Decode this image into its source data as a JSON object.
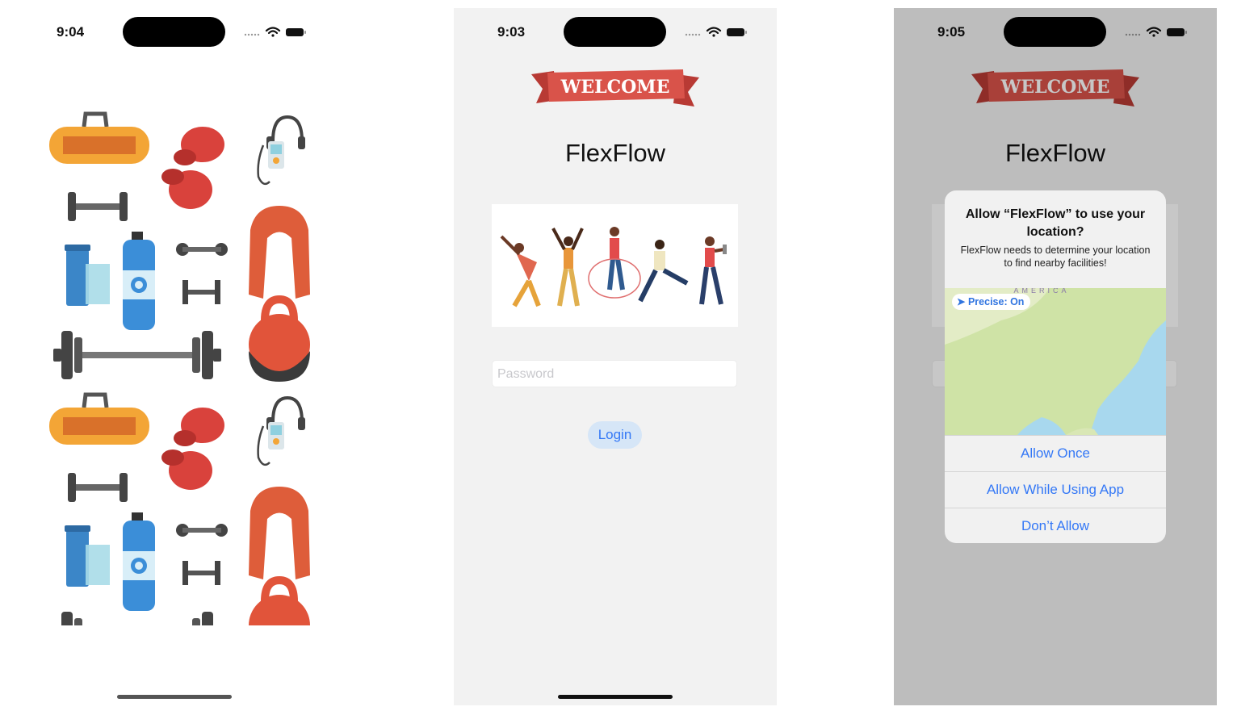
{
  "screens": [
    {
      "status_time": "9:04"
    },
    {
      "status_time": "9:03",
      "banner_text": "WELCOME",
      "app_title": "FlexFlow",
      "password_placeholder": "Password",
      "login_label": "Login"
    },
    {
      "status_time": "9:05",
      "banner_text": "WELCOME",
      "app_title": "FlexFlow",
      "alert": {
        "title": "Allow “FlexFlow” to use your location?",
        "message": "FlexFlow needs to determine your location to find nearby facilities!",
        "map_label": "AMERICA",
        "precise_label": "Precise: On",
        "buttons": [
          "Allow Once",
          "Allow While Using App",
          "Don’t Allow"
        ]
      }
    }
  ],
  "colors": {
    "accent": "#3478f6",
    "banner_red": "#d9534a",
    "phone_bg": "#f2f2f2",
    "dim_bg": "#c9c9c9",
    "map_water": "#a8d8ee",
    "map_land": "#cfe3a6"
  },
  "icons": [
    "wifi-icon",
    "battery-icon",
    "signal-dots-icon",
    "location-arrow-icon",
    "gym-bag-icon",
    "boxing-gloves-icon",
    "music-player-icon",
    "dumbbell-icon",
    "water-bottle-icon",
    "shaker-cup-icon",
    "barbell-icon",
    "towel-icon",
    "kettlebell-icon"
  ]
}
